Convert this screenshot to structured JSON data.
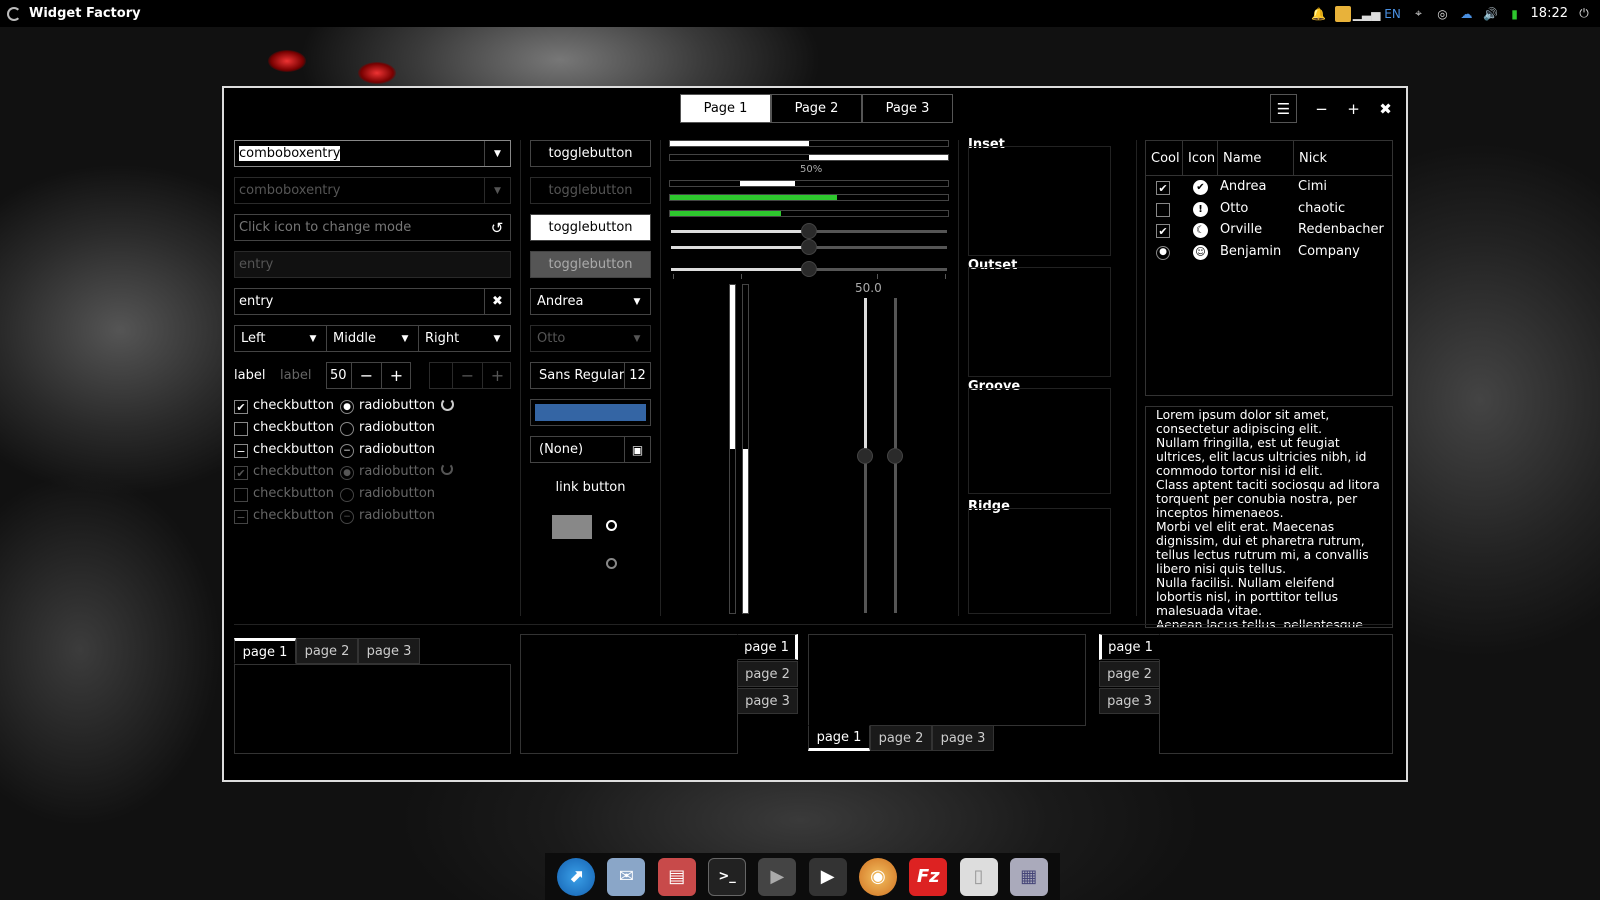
{
  "panel": {
    "app_title": "Widget Factory",
    "lang": "EN",
    "time": "18:22"
  },
  "window": {
    "stack_pages": [
      "Page 1",
      "Page 2",
      "Page 3"
    ],
    "active_page": 0
  },
  "col1": {
    "combo1": "comboboxentry",
    "combo2": "comboboxentry",
    "entry_icon_placeholder": "Click icon to change mode",
    "entry_dim": "entry",
    "entry_clear": "entry",
    "combos": [
      "Left",
      "Middle",
      "Right"
    ],
    "label1": "label",
    "label2": "label",
    "spin_value": "50",
    "checks": [
      {
        "label": "checkbutton",
        "state": "checked",
        "dim": false
      },
      {
        "label": "checkbutton",
        "state": "unchecked",
        "dim": false
      },
      {
        "label": "checkbutton",
        "state": "mixed",
        "dim": false
      },
      {
        "label": "checkbutton",
        "state": "checked",
        "dim": true
      },
      {
        "label": "checkbutton",
        "state": "unchecked",
        "dim": true
      },
      {
        "label": "checkbutton",
        "state": "mixed",
        "dim": true
      }
    ],
    "radios": [
      {
        "label": "radiobutton",
        "state": "checked",
        "dim": false
      },
      {
        "label": "radiobutton",
        "state": "unchecked",
        "dim": false
      },
      {
        "label": "radiobutton",
        "state": "mixed",
        "dim": false
      },
      {
        "label": "radiobutton",
        "state": "checked",
        "dim": true
      },
      {
        "label": "radiobutton",
        "state": "unchecked",
        "dim": true
      },
      {
        "label": "radiobutton",
        "state": "mixed",
        "dim": true
      }
    ]
  },
  "col2": {
    "toggles": [
      "togglebutton",
      "togglebutton",
      "togglebutton",
      "togglebutton"
    ],
    "combo_andrea": "Andrea",
    "combo_otto": "Otto",
    "font_name": "Sans Regular",
    "font_size": "12",
    "color_value": "#3465a4",
    "file_chooser": "(None)",
    "link": "link button"
  },
  "col3": {
    "progress_label": "50%",
    "scale_value": "50.0",
    "progress": [
      0.5,
      0.5,
      0.45,
      0.6,
      0.4
    ],
    "hscale": [
      0.5,
      0.5,
      0.5
    ],
    "vprogress": [
      0.5,
      0.5
    ],
    "vscale": [
      0.5,
      0.5
    ]
  },
  "frames": [
    "Inset",
    "Outset",
    "Groove",
    "Ridge"
  ],
  "tree": {
    "headers": [
      "Cool",
      "Icon",
      "Name",
      "Nick"
    ],
    "rows": [
      {
        "cool": "checked",
        "icon": "check-circle-icon",
        "name": "Andrea",
        "nick": "Cimi"
      },
      {
        "cool": "unchecked",
        "icon": "alert-icon",
        "name": "Otto",
        "nick": "chaotic"
      },
      {
        "cool": "checked",
        "icon": "moon-icon",
        "name": "Orville",
        "nick": "Redenbacher"
      },
      {
        "cool": "radio",
        "icon": "face-icon",
        "name": "Benjamin",
        "nick": "Company"
      }
    ]
  },
  "textview": "Lorem ipsum dolor sit amet, consectetur adipiscing elit.\nNullam fringilla, est ut feugiat ultrices, elit lacus ultricies nibh, id commodo tortor nisi id elit.\nClass aptent taciti sociosqu ad litora torquent per conubia nostra, per inceptos himenaeos.\nMorbi vel elit erat. Maecenas dignissim, dui et pharetra rutrum, tellus lectus rutrum mi, a convallis libero nisi quis tellus.\nNulla facilisi. Nullam eleifend lobortis nisl, in porttitor tellus malesuada vitae.\nAenean lacus tellus, pellentesque quis molestie quis, fringilla in arcu.",
  "notebooks": [
    {
      "tabs": [
        "page 1",
        "page 2",
        "page 3"
      ],
      "position": "top"
    },
    {
      "tabs": [
        "page 1",
        "page 2",
        "page 3"
      ],
      "position": "right"
    },
    {
      "tabs": [
        "page 1",
        "page 2",
        "page 3"
      ],
      "position": "bottom"
    },
    {
      "tabs": [
        "page 1",
        "page 2",
        "page 3"
      ],
      "position": "left"
    }
  ],
  "dock": [
    "browser-icon",
    "mail-icon",
    "image-viewer-icon",
    "terminal-icon",
    "media-player-icon",
    "video-editor-icon",
    "cd-burner-icon",
    "filezilla-icon",
    "text-editor-icon",
    "settings-icon"
  ]
}
